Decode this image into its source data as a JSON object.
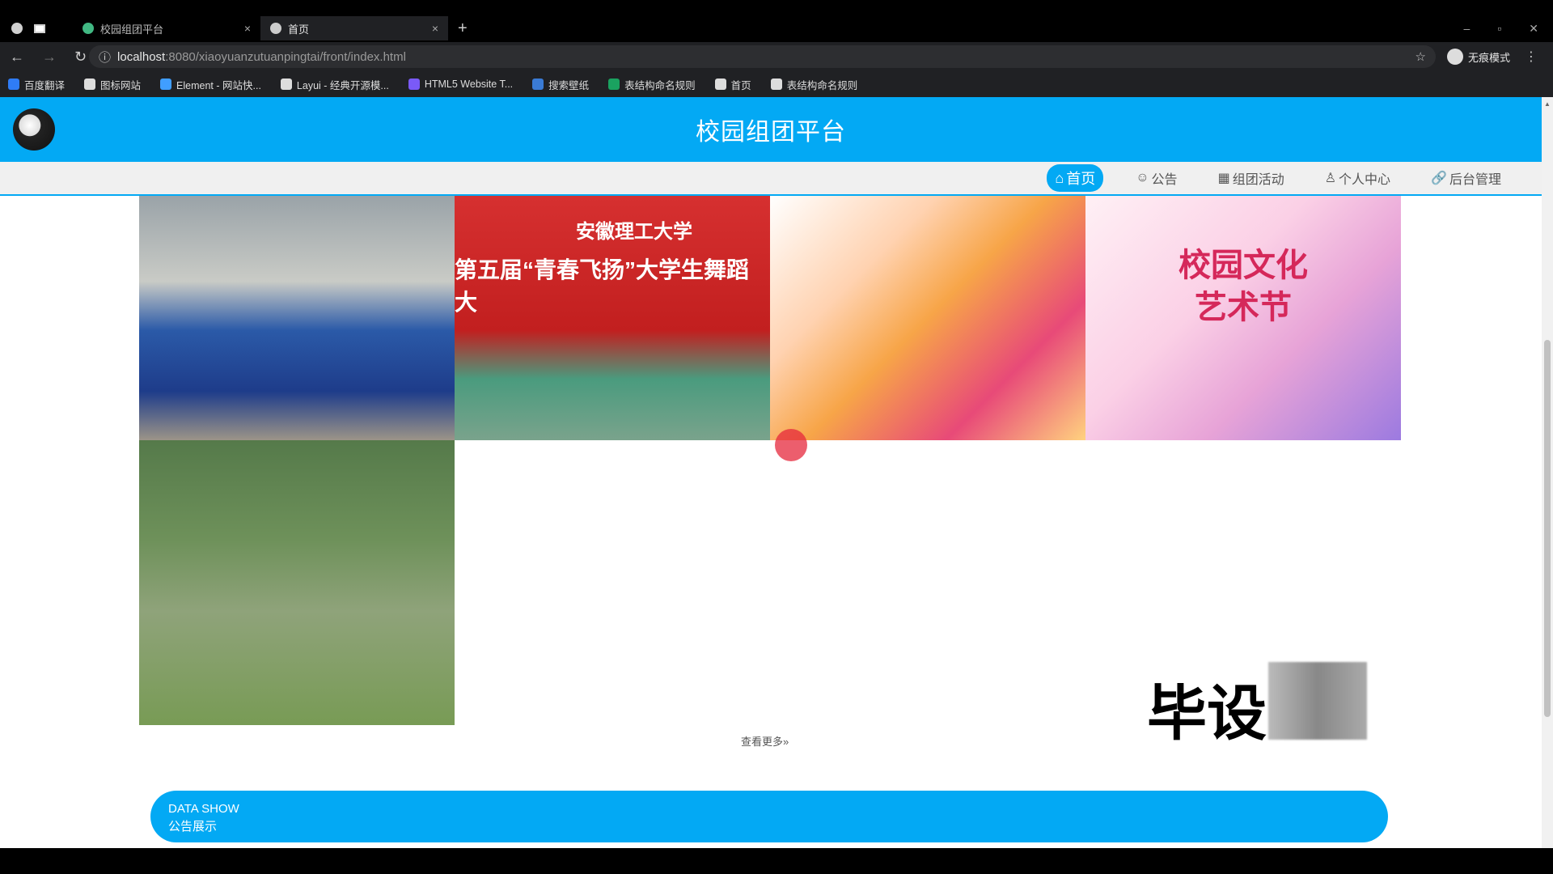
{
  "browser": {
    "tabs": [
      {
        "title": "校园组团平台",
        "active": false
      },
      {
        "title": "首页",
        "active": true
      }
    ],
    "url_host": "localhost",
    "url_rest": ":8080/xiaoyuanzutuanpingtai/front/index.html",
    "profile_label": "无痕模式",
    "bookmarks": [
      {
        "label": "百度翻译",
        "icon": "translate-icon",
        "color": "#2f7cf6"
      },
      {
        "label": "图标网站",
        "icon": "flag-icon",
        "color": "#dddddd"
      },
      {
        "label": "Element - 网站快...",
        "icon": "element-icon",
        "color": "#409eff"
      },
      {
        "label": "Layui - 经典开源模...",
        "icon": "layui-icon",
        "color": "#dddddd"
      },
      {
        "label": "HTML5 Website T...",
        "icon": "html5-icon",
        "color": "#7a5af8"
      },
      {
        "label": "搜索壁纸",
        "icon": "wallpaper-icon",
        "color": "#3a7bd5"
      },
      {
        "label": "表结构命名规则",
        "icon": "sheet-icon",
        "color": "#1aa260"
      },
      {
        "label": "首页",
        "icon": "globe-icon",
        "color": "#dddddd"
      },
      {
        "label": "表结构命名规则",
        "icon": "globe-icon",
        "color": "#dddddd"
      }
    ]
  },
  "site": {
    "title": "校园组团平台",
    "nav": [
      {
        "label": "首页",
        "icon": "home-icon",
        "active": true
      },
      {
        "label": "公告",
        "icon": "notice-icon",
        "active": false
      },
      {
        "label": "组团活动",
        "icon": "activity-icon",
        "active": false
      },
      {
        "label": "个人中心",
        "icon": "user-icon",
        "active": false
      },
      {
        "label": "后台管理",
        "icon": "link-icon",
        "active": false
      }
    ],
    "gallery_text": {
      "img2_uni": "安徽理工大学",
      "img2_banner": "第五届“青春飞扬”大学生舞蹈大",
      "img4_title": "校园文化艺术节"
    },
    "more_label": "查看更多",
    "watermark_text": "毕设",
    "section": {
      "title_en": "DATA SHOW",
      "title_cn": "公告展示"
    }
  },
  "colors": {
    "primary": "#03a9f4"
  }
}
